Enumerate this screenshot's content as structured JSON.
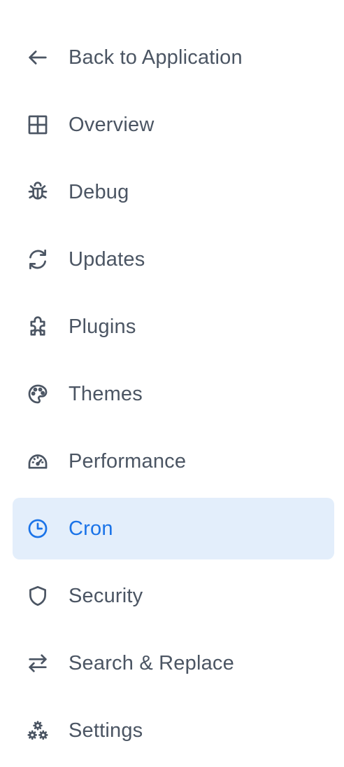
{
  "sidebar": {
    "items": [
      {
        "label": "Back to Application",
        "icon": "arrow-left-icon"
      },
      {
        "label": "Overview",
        "icon": "grid-icon"
      },
      {
        "label": "Debug",
        "icon": "bug-icon"
      },
      {
        "label": "Updates",
        "icon": "refresh-icon"
      },
      {
        "label": "Plugins",
        "icon": "puzzle-icon"
      },
      {
        "label": "Themes",
        "icon": "palette-icon"
      },
      {
        "label": "Performance",
        "icon": "gauge-icon"
      },
      {
        "label": "Cron",
        "icon": "clock-icon",
        "active": true
      },
      {
        "label": "Security",
        "icon": "shield-icon"
      },
      {
        "label": "Search & Replace",
        "icon": "arrows-swap-icon"
      },
      {
        "label": "Settings",
        "icon": "cogs-icon"
      }
    ]
  },
  "colors": {
    "text": "#4b5563",
    "active_text": "#1a73e8",
    "active_background": "#e3eefb"
  }
}
